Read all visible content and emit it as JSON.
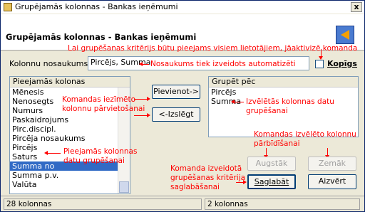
{
  "window": {
    "title": "Grupējamās kolonnas - Bankas ieņēmumi",
    "close_glyph": "x"
  },
  "header": {
    "title": "Grupējamās kolonnas - Bankas ieņēmumi",
    "icon": "export-arrow-icon"
  },
  "column_name": {
    "label": "Kolonnu nosaukums",
    "value": "Pircējs, Summa"
  },
  "kopigs": {
    "label": "Kopīgs",
    "checked": false
  },
  "available": {
    "header": "Pieejamās kolonas",
    "items": [
      "Mēnesis",
      "Nenosegts",
      "Numurs",
      "Paskaidrojums",
      "Pirc.discipl.",
      "Pircēja nosaukums",
      "Pircējs",
      "Saturs",
      "Summa no",
      "Summa p.v.",
      "Valūta"
    ],
    "selected_index": 8
  },
  "grouped": {
    "header": "Grupēt pēc",
    "items": [
      "Pircējs",
      "Summa"
    ]
  },
  "buttons": {
    "add": "Pievienot->",
    "remove": "<-Izslēgt",
    "up": "Augstāk",
    "down": "Zemāk",
    "save": "Saglabāt",
    "close": "Aizvērt"
  },
  "status": {
    "left": "28 kolonnas",
    "right": "2 kolonnas"
  },
  "annotations": {
    "kopigs_note": "Lai grupēšanas kritērijs būtu pieejams visiem lietotājiem, jāaktivizē komanda",
    "name_note": "Nosaukums tiek izveidots automatizēti",
    "move_note_1": "Komandas iezīmēto",
    "move_note_2": "kolonnu pārvietošanai",
    "grouped_note_1": "Izvēlētās kolonnas datu",
    "grouped_note_2": "grupēšanai",
    "order_note_1": "Komandas izvēlēto kolonnu",
    "order_note_2": "pārbīdīšanai",
    "available_note_1": "Pieejamās kolonnas",
    "available_note_2": "datu grupēšanai",
    "save_note_1": "Komanda izveidotā",
    "save_note_2": "grupēšanas kritērija",
    "save_note_3": "saglabāšanai"
  },
  "colors": {
    "selection": "#316ac5",
    "annotation": "#ff0000",
    "window_bg": "#ece9d8"
  }
}
